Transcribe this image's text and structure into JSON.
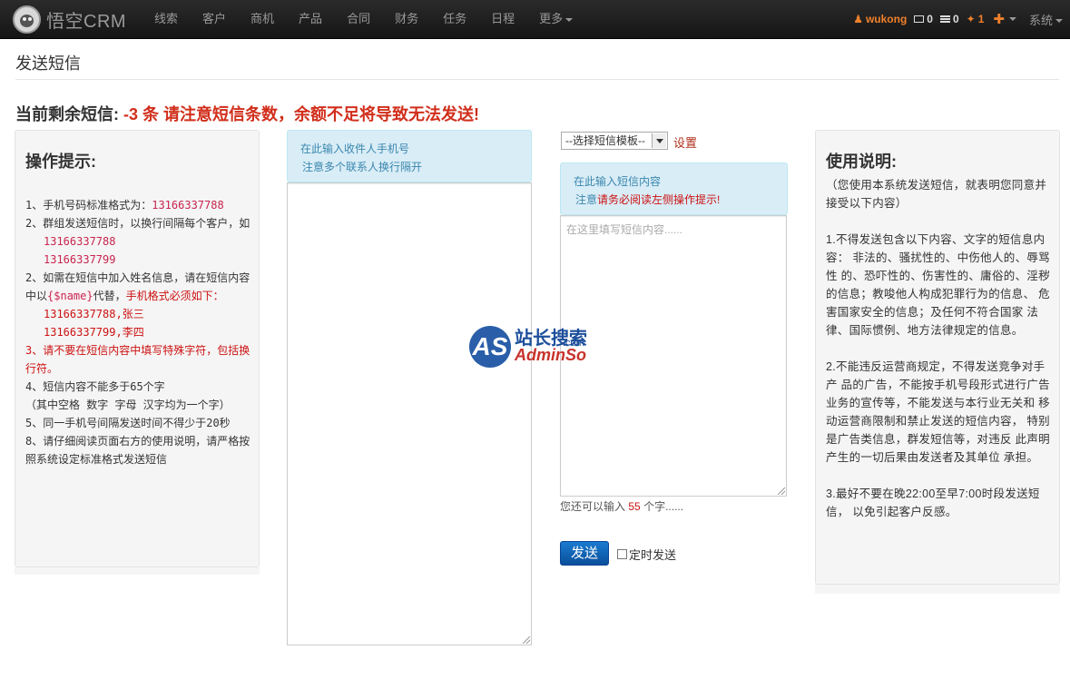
{
  "app": {
    "brand": "悟空CRM"
  },
  "nav": {
    "items": [
      "线索",
      "客户",
      "商机",
      "产品",
      "合同",
      "财务",
      "任务",
      "日程"
    ],
    "more": "更多"
  },
  "user": {
    "name": "wukong",
    "messages": "0",
    "tasks": "0",
    "notices": "1",
    "system": "系统"
  },
  "page": {
    "title": "发送短信",
    "remain_label": "当前剩余短信:",
    "remain_value": "-3 条 请注意短信条数，余额不足将导致无法发送!"
  },
  "tips": {
    "title": "操作提示:",
    "t1_prefix": "1、手机号码标准格式为：",
    "t1_num": "13166337788",
    "t2": "2、群组发送短信时，以换行间隔每个客户，如",
    "t2_a": "13166337788",
    "t2_b": "13166337799",
    "t3_a": "2、如需在短信中加入姓名信息，请在短信内容中以",
    "t3_code": "{$name}",
    "t3_b": "代替，",
    "t3_red": "手机格式必须如下：",
    "t3_e1": "13166337788,张三",
    "t3_e2": "13166337799,李四",
    "t4": "3、请不要在短信内容中填写特殊字符，包括换行符。",
    "t5": "4、短信内容不能多于65个字",
    "t5b": "（其中空格 数字 字母 汉字均为一个字）",
    "t6": "5、同一手机号间隔发送时间不得少于20秒",
    "t7": "8、请仔细阅读页面右方的使用说明，请严格按照系统设定标准格式发送短信"
  },
  "recipients": {
    "hint1": "在此输入收件人手机号",
    "hint2": "注意多个联系人换行隔开"
  },
  "content": {
    "template_select": "--选择短信模板--",
    "settings_link": "设置",
    "hint1": "在此输入短信内容",
    "hint2_prefix": "注意",
    "hint2_red": "请务必阅读左侧操作提示!",
    "placeholder": "在这里填写短信内容......",
    "count_prefix": "您还可以输入",
    "count_num": "55",
    "count_suffix": "个字......",
    "send_label": "发送",
    "timed_label": "定时发送"
  },
  "usage": {
    "title": "使用说明:",
    "p0": "（您使用本系统发送短信，就表明您同意并接受以下内容）",
    "p1": "1.不得发送包含以下内容、文字的短信息内容： 非法的、骚扰性的、中伤他人的、辱骂性 的、恐吓性的、伤害性的、庸俗的、淫秽 的信息；教唆他人构成犯罪行为的信息、 危害国家安全的信息；及任何不符合国家 法律、国际惯例、地方法律规定的信息。",
    "p2": "2.不能违反运营商规定，不得发送竞争对手产 品的广告，不能按手机号段形式进行广告 业务的宣传等，不能发送与本行业无关和 移动运营商限制和禁止发送的短信内容， 特别是广告类信息，群发短信等，对违反 此声明产生的一切后果由发送者及其单位 承担。",
    "p3": "3.最好不要在晚22:00至早7:00时段发送短信， 以免引起客户反感。"
  },
  "watermark": {
    "as": "AS",
    "cn": "站长搜索",
    "en": "AdminSo",
    "com": ".com"
  }
}
